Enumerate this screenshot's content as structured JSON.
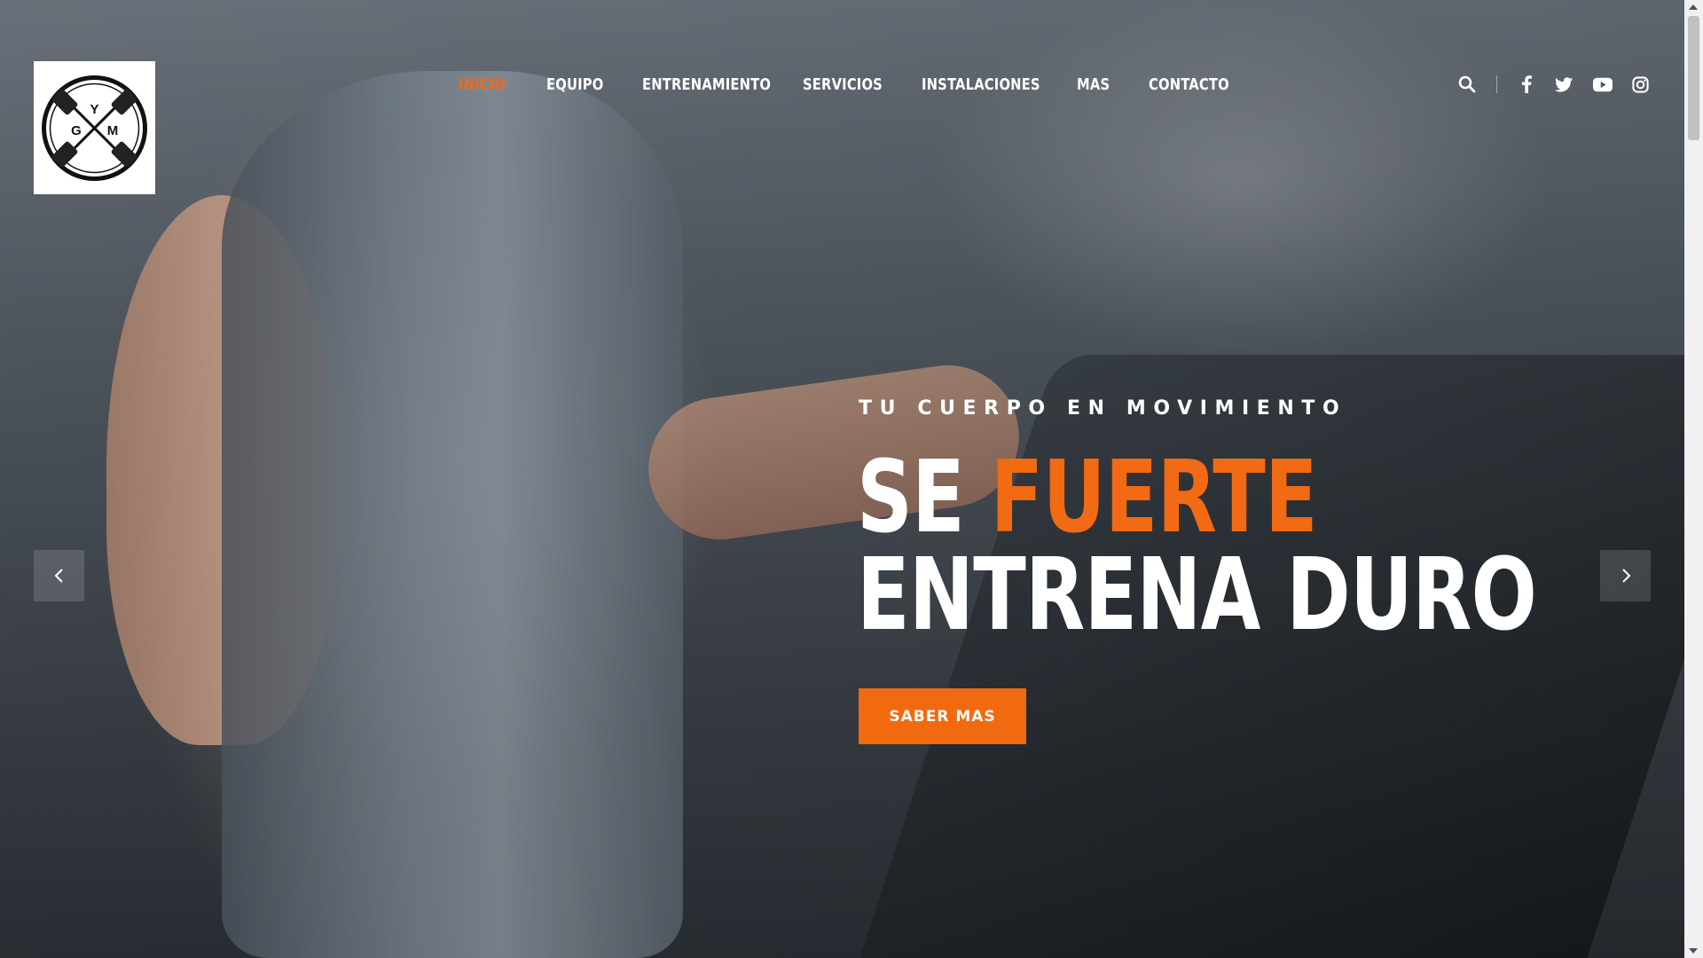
{
  "header": {
    "logo": {
      "letters": [
        "G",
        "Y",
        "M"
      ],
      "alt_icon": "gym-dumbbell-logo"
    },
    "nav": [
      {
        "label": "INICIO",
        "active": true
      },
      {
        "label": "EQUIPO",
        "active": false
      },
      {
        "label": "ENTRENAMIENTO",
        "active": false
      },
      {
        "label": "SERVICIOS",
        "active": false
      },
      {
        "label": "INSTALACIONES",
        "active": false
      },
      {
        "label": "MAS",
        "active": false
      },
      {
        "label": "CONTACTO",
        "active": false
      }
    ],
    "icons": [
      "search-icon",
      "facebook-icon",
      "twitter-icon",
      "youtube-icon",
      "instagram-icon"
    ]
  },
  "hero": {
    "kicker": "TU CUERPO EN MOVIMIENTO",
    "headline_line1_part1": "SE ",
    "headline_line1_accent": "FUERTE",
    "headline_line2": "ENTRENA DURO",
    "cta_label": "SABER MAS",
    "prev_icon": "chevron-left-icon",
    "next_icon": "chevron-right-icon"
  },
  "colors": {
    "accent": "#f26a13",
    "text": "#ffffff"
  }
}
